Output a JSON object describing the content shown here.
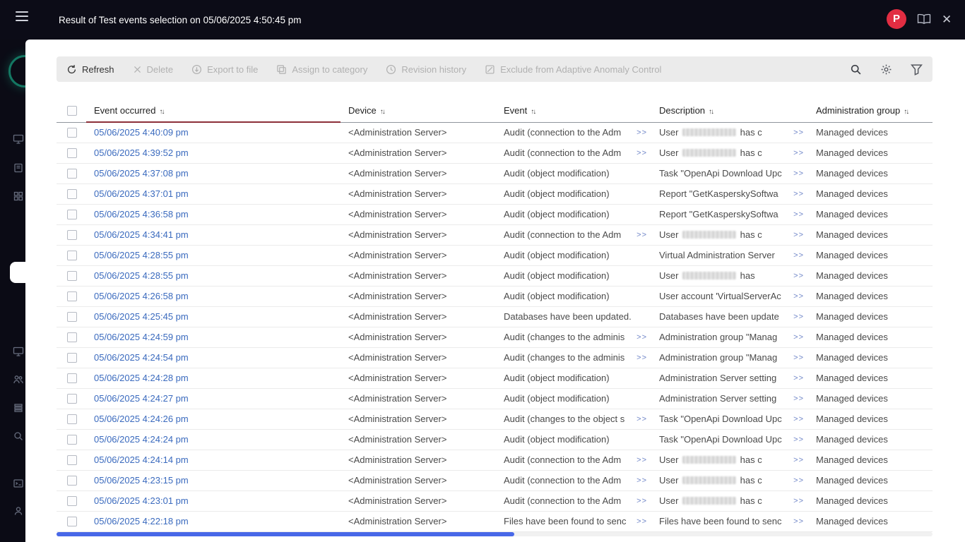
{
  "header": {
    "title": "Result of Test events selection on 05/06/2025 4:50:45 pm",
    "badge_label": "P"
  },
  "icons": {
    "close": "✕",
    "sort": "↑↓"
  },
  "toolbar": {
    "buttons": [
      {
        "label": "Refresh",
        "enabled": true,
        "icon": "refresh-icon"
      },
      {
        "label": "Delete",
        "enabled": false,
        "icon": "delete-icon"
      },
      {
        "label": "Export to file",
        "enabled": false,
        "icon": "export-icon"
      },
      {
        "label": "Assign to category",
        "enabled": false,
        "icon": "category-icon"
      },
      {
        "label": "Revision history",
        "enabled": false,
        "icon": "history-icon"
      },
      {
        "label": "Exclude from Adaptive Anomaly Control",
        "enabled": false,
        "icon": "exclude-icon"
      }
    ]
  },
  "table": {
    "more_label": ">>",
    "columns": [
      "Event occurred",
      "Device",
      "Event",
      "Description",
      "Administration group"
    ],
    "rows": [
      {
        "time": "05/06/2025 4:40:09 pm",
        "device": "<Administration Server>",
        "event": "Audit (connection to the Adm",
        "event_more": true,
        "desc": {
          "pre": "User ",
          "redacted": true,
          "suf": " has c",
          "more": true
        },
        "group": "Managed devices"
      },
      {
        "time": "05/06/2025 4:39:52 pm",
        "device": "<Administration Server>",
        "event": "Audit (connection to the Adm",
        "event_more": true,
        "desc": {
          "pre": "User ",
          "redacted": true,
          "suf": " has c",
          "more": true
        },
        "group": "Managed devices"
      },
      {
        "time": "05/06/2025 4:37:08 pm",
        "device": "<Administration Server>",
        "event": "Audit (object modification)",
        "event_more": false,
        "desc": {
          "pre": "Task \"OpenApi Download Upc",
          "redacted": false,
          "suf": "",
          "more": true
        },
        "group": "Managed devices"
      },
      {
        "time": "05/06/2025 4:37:01 pm",
        "device": "<Administration Server>",
        "event": "Audit (object modification)",
        "event_more": false,
        "desc": {
          "pre": "Report \"GetKasperskySoftwa",
          "redacted": false,
          "suf": "",
          "more": true
        },
        "group": "Managed devices"
      },
      {
        "time": "05/06/2025 4:36:58 pm",
        "device": "<Administration Server>",
        "event": "Audit (object modification)",
        "event_more": false,
        "desc": {
          "pre": "Report \"GetKasperskySoftwa",
          "redacted": false,
          "suf": "",
          "more": true
        },
        "group": "Managed devices"
      },
      {
        "time": "05/06/2025 4:34:41 pm",
        "device": "<Administration Server>",
        "event": "Audit (connection to the Adm",
        "event_more": true,
        "desc": {
          "pre": "User ",
          "redacted": true,
          "suf": " has c",
          "more": true
        },
        "group": "Managed devices"
      },
      {
        "time": "05/06/2025 4:28:55 pm",
        "device": "<Administration Server>",
        "event": "Audit (object modification)",
        "event_more": false,
        "desc": {
          "pre": "Virtual Administration Server",
          "redacted": false,
          "suf": "",
          "more": true
        },
        "group": "Managed devices"
      },
      {
        "time": "05/06/2025 4:28:55 pm",
        "device": "<Administration Server>",
        "event": "Audit (object modification)",
        "event_more": false,
        "desc": {
          "pre": "User ",
          "redacted": true,
          "suf": " has",
          "more": true
        },
        "group": "Managed devices"
      },
      {
        "time": "05/06/2025 4:26:58 pm",
        "device": "<Administration Server>",
        "event": "Audit (object modification)",
        "event_more": false,
        "desc": {
          "pre": "User account 'VirtualServerAc",
          "redacted": false,
          "suf": "",
          "more": true
        },
        "group": "Managed devices"
      },
      {
        "time": "05/06/2025 4:25:45 pm",
        "device": "<Administration Server>",
        "event": "Databases have been updated.",
        "event_more": false,
        "desc": {
          "pre": "Databases have been update",
          "redacted": false,
          "suf": "",
          "more": true
        },
        "group": "Managed devices"
      },
      {
        "time": "05/06/2025 4:24:59 pm",
        "device": "<Administration Server>",
        "event": "Audit (changes to the adminis",
        "event_more": true,
        "desc": {
          "pre": "Administration group \"Manag",
          "redacted": false,
          "suf": "",
          "more": true
        },
        "group": "Managed devices"
      },
      {
        "time": "05/06/2025 4:24:54 pm",
        "device": "<Administration Server>",
        "event": "Audit (changes to the adminis",
        "event_more": true,
        "desc": {
          "pre": "Administration group \"Manag",
          "redacted": false,
          "suf": "",
          "more": true
        },
        "group": "Managed devices"
      },
      {
        "time": "05/06/2025 4:24:28 pm",
        "device": "<Administration Server>",
        "event": "Audit (object modification)",
        "event_more": false,
        "desc": {
          "pre": "Administration Server setting",
          "redacted": false,
          "suf": "",
          "more": true
        },
        "group": "Managed devices"
      },
      {
        "time": "05/06/2025 4:24:27 pm",
        "device": "<Administration Server>",
        "event": "Audit (object modification)",
        "event_more": false,
        "desc": {
          "pre": "Administration Server setting",
          "redacted": false,
          "suf": "",
          "more": true
        },
        "group": "Managed devices"
      },
      {
        "time": "05/06/2025 4:24:26 pm",
        "device": "<Administration Server>",
        "event": "Audit (changes to the object s",
        "event_more": true,
        "desc": {
          "pre": "Task \"OpenApi Download Upc",
          "redacted": false,
          "suf": "",
          "more": true
        },
        "group": "Managed devices"
      },
      {
        "time": "05/06/2025 4:24:24 pm",
        "device": "<Administration Server>",
        "event": "Audit (object modification)",
        "event_more": false,
        "desc": {
          "pre": "Task \"OpenApi Download Upc",
          "redacted": false,
          "suf": "",
          "more": true
        },
        "group": "Managed devices"
      },
      {
        "time": "05/06/2025 4:24:14 pm",
        "device": "<Administration Server>",
        "event": "Audit (connection to the Adm",
        "event_more": true,
        "desc": {
          "pre": "User ",
          "redacted": true,
          "suf": " has c",
          "more": true
        },
        "group": "Managed devices"
      },
      {
        "time": "05/06/2025 4:23:15 pm",
        "device": "<Administration Server>",
        "event": "Audit (connection to the Adm",
        "event_more": true,
        "desc": {
          "pre": "User ",
          "redacted": true,
          "suf": " has c",
          "more": true
        },
        "group": "Managed devices"
      },
      {
        "time": "05/06/2025 4:23:01 pm",
        "device": "<Administration Server>",
        "event": "Audit (connection to the Adm",
        "event_more": true,
        "desc": {
          "pre": "User ",
          "redacted": true,
          "suf": " has c",
          "more": true
        },
        "group": "Managed devices"
      },
      {
        "time": "05/06/2025 4:22:18 pm",
        "device": "<Administration Server>",
        "event": "Files have been found to senc",
        "event_more": true,
        "desc": {
          "pre": "Files have been found to senc",
          "redacted": false,
          "suf": "",
          "more": true
        },
        "group": "Managed devices"
      }
    ]
  },
  "colors": {
    "accent_red": "#e22d42",
    "link_blue": "#3a6abe",
    "scrollbar_blue": "#4868e8",
    "brand_green": "#19b28c"
  }
}
